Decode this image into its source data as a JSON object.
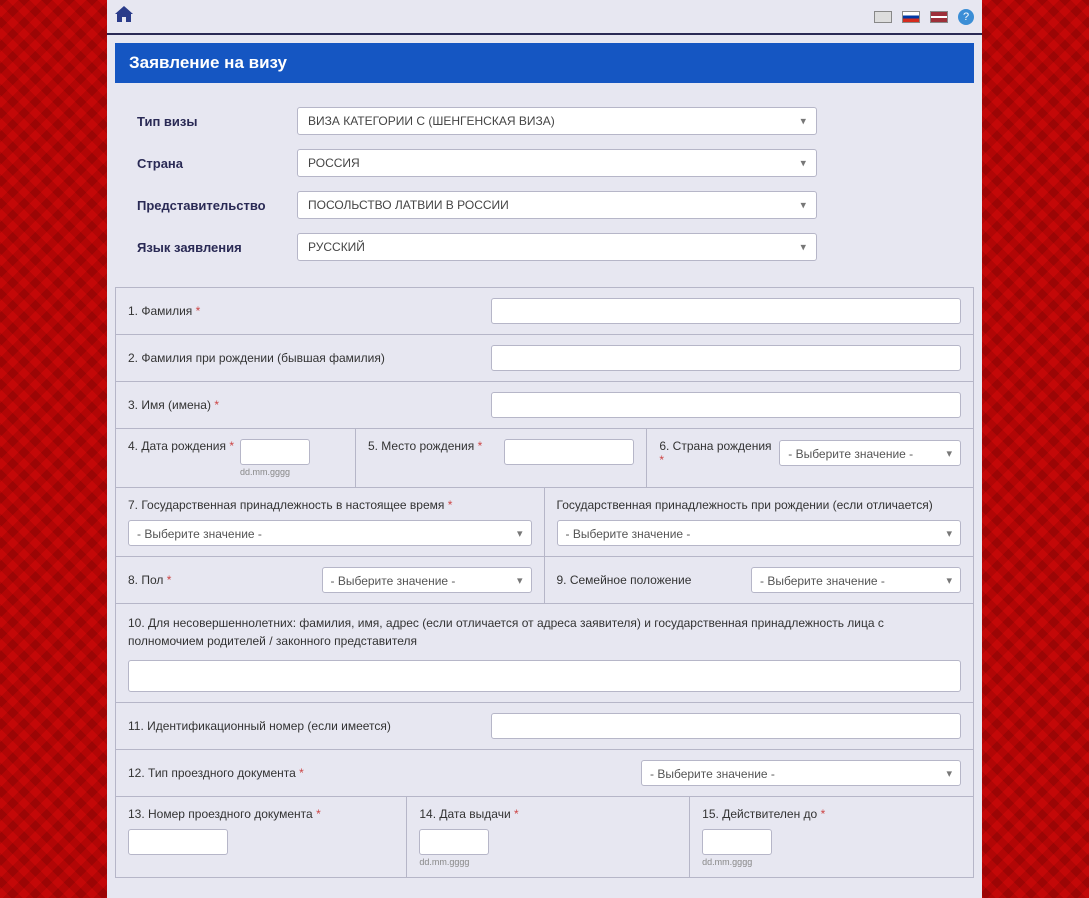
{
  "header": {
    "title": "Заявление на визу"
  },
  "meta": {
    "visa_type_label": "Тип визы",
    "visa_type_value": "ВИЗА КАТЕГОРИИ C (ШЕНГЕНСКАЯ ВИЗА)",
    "country_label": "Страна",
    "country_value": "РОССИЯ",
    "mission_label": "Представительство",
    "mission_value": "ПОСОЛЬСТВО ЛАТВИИ В РОССИИ",
    "lang_label": "Язык заявления",
    "lang_value": "РУССКИЙ"
  },
  "placeholders": {
    "select_value": "- Выберите значение -",
    "date_hint": "dd.mm.gggg"
  },
  "fields": {
    "f1": "1. Фамилия",
    "f2": "2. Фамилия при рождении (бывшая фамилия)",
    "f3": "3. Имя (имена)",
    "f4": "4. Дата рождения",
    "f5": "5. Место рождения",
    "f6": "6. Страна рождения",
    "f7": "7. Государственная принадлежность в настоящее время",
    "f7b": "Государственная принадлежность при рождении (если отличается)",
    "f8": "8. Пол",
    "f9": "9. Семейное положение",
    "f10": "10. Для несовершеннолетних: фамилия, имя, адрес (если отличается от адреса заявителя) и государственная принадлежность лица с полномочием родителей / законного представителя",
    "f11": "11. Идентификационный номер (если имеется)",
    "f12": "12. Тип проездного документа",
    "f13": "13. Номер проездного документа",
    "f14": "14. Дата выдачи",
    "f15": "15. Действителен до"
  }
}
